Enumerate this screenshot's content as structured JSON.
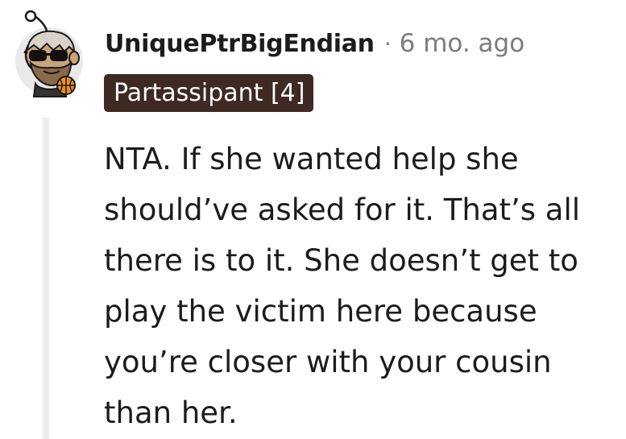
{
  "comment": {
    "author": "UniquePtrBigEndian",
    "separator": "·",
    "timestamp": "6 mo. ago",
    "flair": "Partassipant [4]",
    "avatar_icon": "snoo-avatar-sunglasses-basketball-icon",
    "body_lines": [
      "NTA. If she wanted help she",
      "should’ve asked for it. That’s all",
      "there is to it. She doesn’t get to",
      "play the victim here because",
      "you’re closer with your cousin",
      "than her."
    ]
  },
  "colors": {
    "flair_background": "#3e2a23",
    "flair_text": "#ffffff",
    "meta_gray": "#7c7c7c",
    "thread_line": "#ededed",
    "text": "#1c1c1c"
  }
}
